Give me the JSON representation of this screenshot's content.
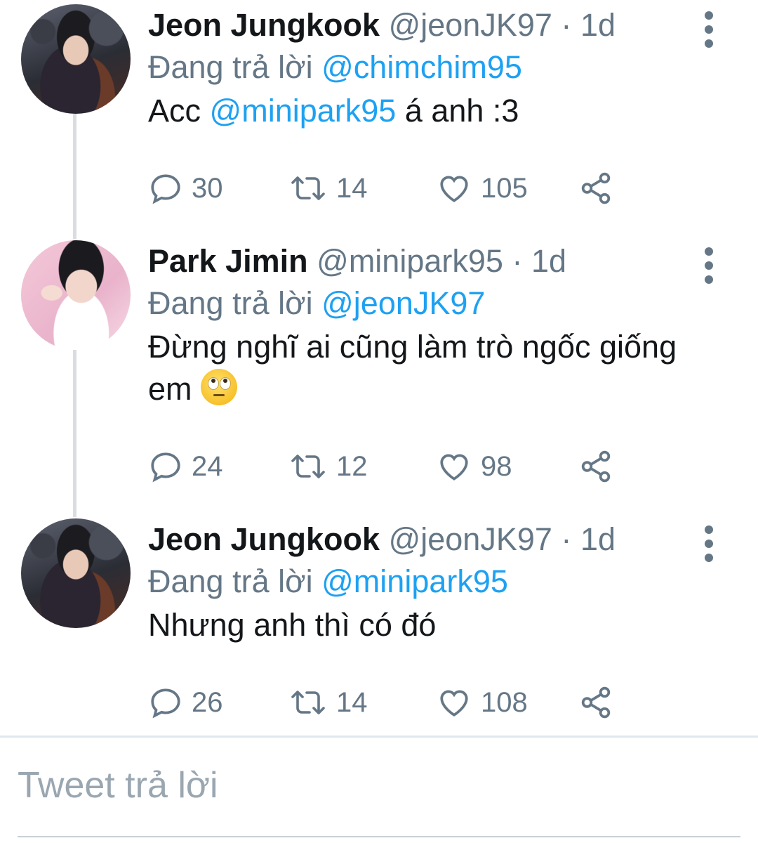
{
  "tweets": [
    {
      "name": "Jeon Jungkook",
      "handle": "@jeonJK97",
      "separator": "·",
      "time": "1d",
      "reply_prefix": "Đang trả lời",
      "reply_to": "@chimchim95",
      "text_before": "Acc ",
      "mention": "@minipark95",
      "text_after": " á anh :3",
      "replies": "30",
      "retweets": "14",
      "likes": "105",
      "avatar": "jungkook-avatar"
    },
    {
      "name": "Park Jimin",
      "handle": "@minipark95",
      "separator": "·",
      "time": "1d",
      "reply_prefix": "Đang trả lời",
      "reply_to": "@jeonJK97",
      "text": "Đừng nghĩ ai cũng làm trò ngốc giống em",
      "emoji": "face-with-rolling-eyes",
      "replies": "24",
      "retweets": "12",
      "likes": "98",
      "avatar": "jimin-avatar"
    },
    {
      "name": "Jeon Jungkook",
      "handle": "@jeonJK97",
      "separator": "·",
      "time": "1d",
      "reply_prefix": "Đang trả lời",
      "reply_to": "@minipark95",
      "text": "Nhưng anh thì có đó",
      "replies": "26",
      "retweets": "14",
      "likes": "108",
      "avatar": "jungkook-avatar"
    }
  ],
  "composer": {
    "placeholder": "Tweet trả lời"
  },
  "colors": {
    "link": "#1da1f2",
    "muted": "#657786",
    "text": "#14171a",
    "thread_line": "#d9dde1"
  }
}
